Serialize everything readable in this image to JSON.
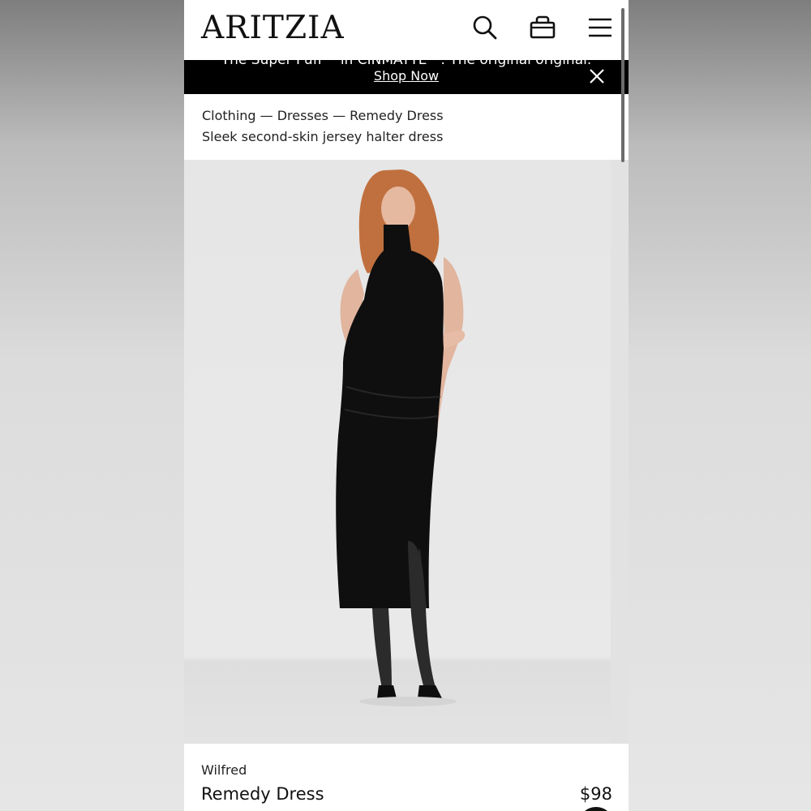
{
  "header": {
    "logo": "ARITZIA",
    "icons": [
      "search-icon",
      "bag-icon",
      "menu-icon"
    ]
  },
  "banner": {
    "text": "The Super Puff™ in CINMATTE™. The original original.",
    "link_label": "Shop Now"
  },
  "breadcrumb": {
    "text": "Clothing — Dresses — Remedy Dress"
  },
  "product": {
    "subtitle": "Sleek second-skin jersey halter dress",
    "brand": "Wilfred",
    "name": "Remedy Dress",
    "price": "$98",
    "swatch_color": "#111111"
  },
  "colors": {
    "banner_bg": "#000000",
    "page_bg": "#ffffff",
    "image_bg": "#e6e6e6"
  }
}
